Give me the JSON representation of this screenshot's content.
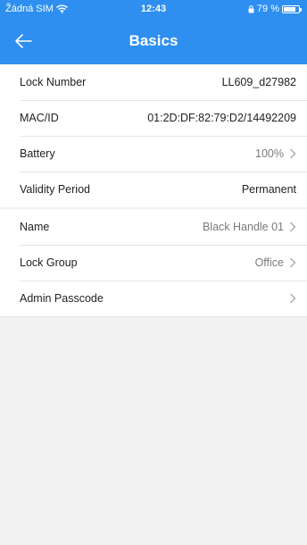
{
  "status_bar": {
    "carrier": "Žádná SIM",
    "time": "12:43",
    "battery_percent_label": "79 %",
    "battery_level": 0.79
  },
  "nav": {
    "title": "Basics"
  },
  "details": [
    {
      "label": "Lock Number",
      "value": "LL609_d27982"
    },
    {
      "label": "MAC/ID",
      "value": "01:2D:DF:82:79:D2/14492209"
    },
    {
      "label": "Battery",
      "value": "100%"
    },
    {
      "label": "Validity Period",
      "value": "Permanent"
    }
  ],
  "settings": [
    {
      "label": "Name",
      "value": "Black Handle 01"
    },
    {
      "label": "Lock Group",
      "value": "Office"
    },
    {
      "label": "Admin Passcode",
      "value": ""
    }
  ],
  "colors": {
    "accent": "#2e8ff0",
    "background": "#f2f2f2"
  }
}
